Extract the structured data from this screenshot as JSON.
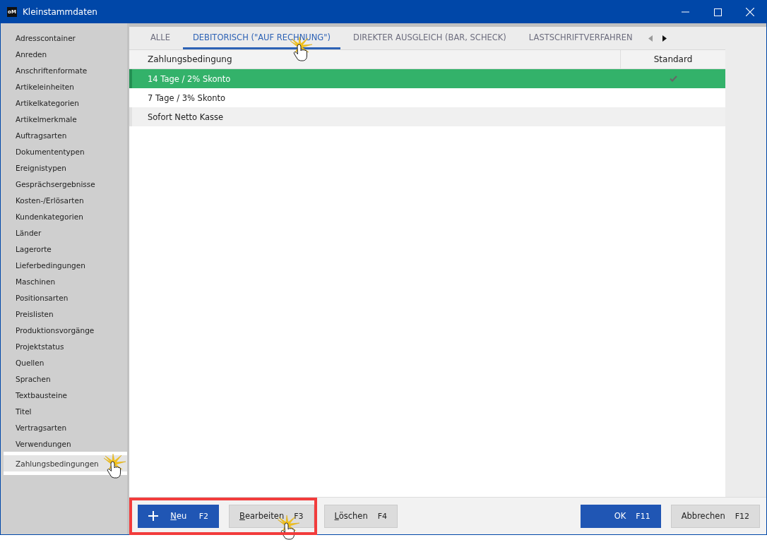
{
  "window": {
    "title": "Kleinstammdaten",
    "logo": "oM"
  },
  "sidebar": {
    "items": [
      {
        "label": "Adresscontainer",
        "selected": false
      },
      {
        "label": "Anreden",
        "selected": false
      },
      {
        "label": "Anschriftenformate",
        "selected": false
      },
      {
        "label": "Artikeleinheiten",
        "selected": false
      },
      {
        "label": "Artikelkategorien",
        "selected": false
      },
      {
        "label": "Artikelmerkmale",
        "selected": false
      },
      {
        "label": "Auftragsarten",
        "selected": false
      },
      {
        "label": "Dokumententypen",
        "selected": false
      },
      {
        "label": "Ereignistypen",
        "selected": false
      },
      {
        "label": "Gesprächsergebnisse",
        "selected": false
      },
      {
        "label": "Kosten-/Erlösarten",
        "selected": false
      },
      {
        "label": "Kundenkategorien",
        "selected": false
      },
      {
        "label": "Länder",
        "selected": false
      },
      {
        "label": "Lagerorte",
        "selected": false
      },
      {
        "label": "Lieferbedingungen",
        "selected": false
      },
      {
        "label": "Maschinen",
        "selected": false
      },
      {
        "label": "Positionsarten",
        "selected": false
      },
      {
        "label": "Preislisten",
        "selected": false
      },
      {
        "label": "Produktionsvorgänge",
        "selected": false
      },
      {
        "label": "Projektstatus",
        "selected": false
      },
      {
        "label": "Quellen",
        "selected": false
      },
      {
        "label": "Sprachen",
        "selected": false
      },
      {
        "label": "Textbausteine",
        "selected": false
      },
      {
        "label": "Titel",
        "selected": false
      },
      {
        "label": "Vertragsarten",
        "selected": false
      },
      {
        "label": "Verwendungen",
        "selected": false
      },
      {
        "label": "Zahlungsbedingungen",
        "selected": true
      }
    ]
  },
  "tabs": [
    {
      "label": "ALLE",
      "selected": false
    },
    {
      "label": "DEBITORISCH (\"AUF RECHNUNG\")",
      "selected": true
    },
    {
      "label": "DIREKTER AUSGLEICH (BAR, SCHECK)",
      "selected": false
    },
    {
      "label": "LASTSCHRIFTVERFAHREN",
      "selected": false
    }
  ],
  "table": {
    "columns": [
      "Zahlungsbedingung",
      "Standard"
    ],
    "rows": [
      {
        "name": "14 Tage / 2% Skonto",
        "standard": true,
        "selected": true
      },
      {
        "name": "7 Tage / 3% Skonto",
        "standard": false,
        "selected": false
      },
      {
        "name": "Sofort Netto Kasse",
        "standard": false,
        "selected": false
      }
    ]
  },
  "toolbar": {
    "highlighted": true,
    "buttons": [
      {
        "kind": "add",
        "label": "Neu",
        "key": "F2",
        "mnemonic": true
      },
      {
        "kind": "plain",
        "label": "Bearbeiten",
        "key": "F3",
        "mnemonic": true
      },
      {
        "kind": "plain",
        "label": "Löschen",
        "key": "F4",
        "mnemonic": true
      }
    ]
  },
  "dialog_buttons": [
    {
      "kind": "primary",
      "label": "OK",
      "key": "F11",
      "mnemonic": false
    },
    {
      "kind": "plain",
      "label": "Abbrechen",
      "key": "F12",
      "mnemonic": false
    }
  ]
}
